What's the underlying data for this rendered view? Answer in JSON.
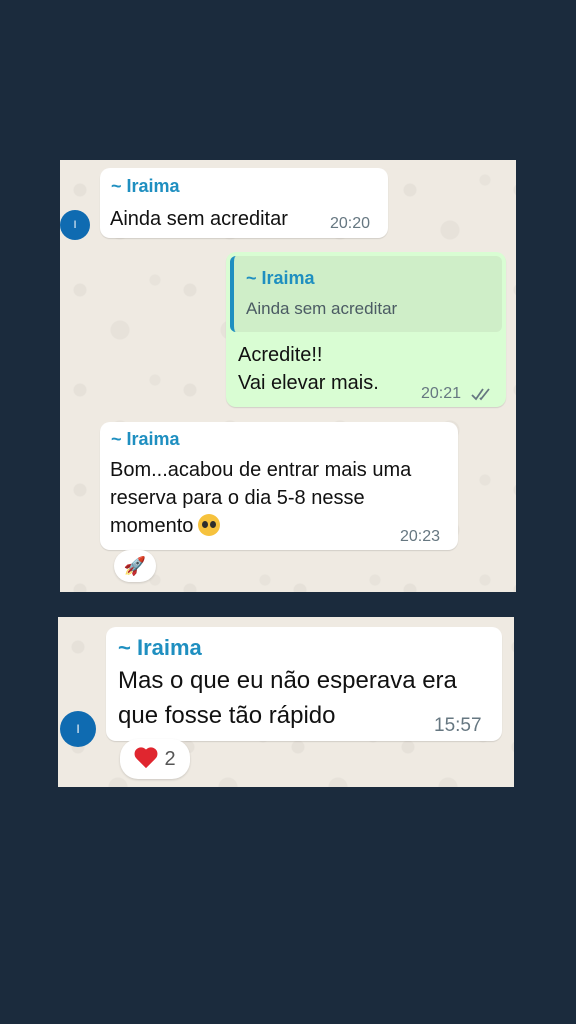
{
  "messages": [
    {
      "sender": "~ Iraima",
      "text": "Ainda sem acreditar",
      "time": "20:20",
      "avatar_initial": "I"
    },
    {
      "quote_sender": "~ Iraima",
      "quote_text": "Ainda sem acreditar",
      "line1": "Acredite!!",
      "line2": "Vai elevar mais.",
      "time": "20:21",
      "status_icon": "double-check-icon"
    },
    {
      "sender": "~ Iraima",
      "line1": "Bom...acabou de entrar mais uma",
      "line2": "reserva para o dia 5-8 nesse",
      "line3": "momento",
      "emoji": "pleading-face-emoji",
      "time": "20:23",
      "reaction_emoji": "🚀"
    }
  ],
  "panel2": {
    "sender": "~ Iraima",
    "line1": "Mas o que eu não esperava era",
    "line2": "que fosse tão rápido",
    "time": "15:57",
    "avatar_initial": "I",
    "reaction_emoji": "heart-icon",
    "reaction_count": "2"
  },
  "colors": {
    "background": "#1b2b3d",
    "chat_background": "#efeae2",
    "incoming_bubble": "#ffffff",
    "outgoing_bubble": "#d9fdd3",
    "sender_name": "#1f8fc0",
    "timestamp": "#667781"
  }
}
